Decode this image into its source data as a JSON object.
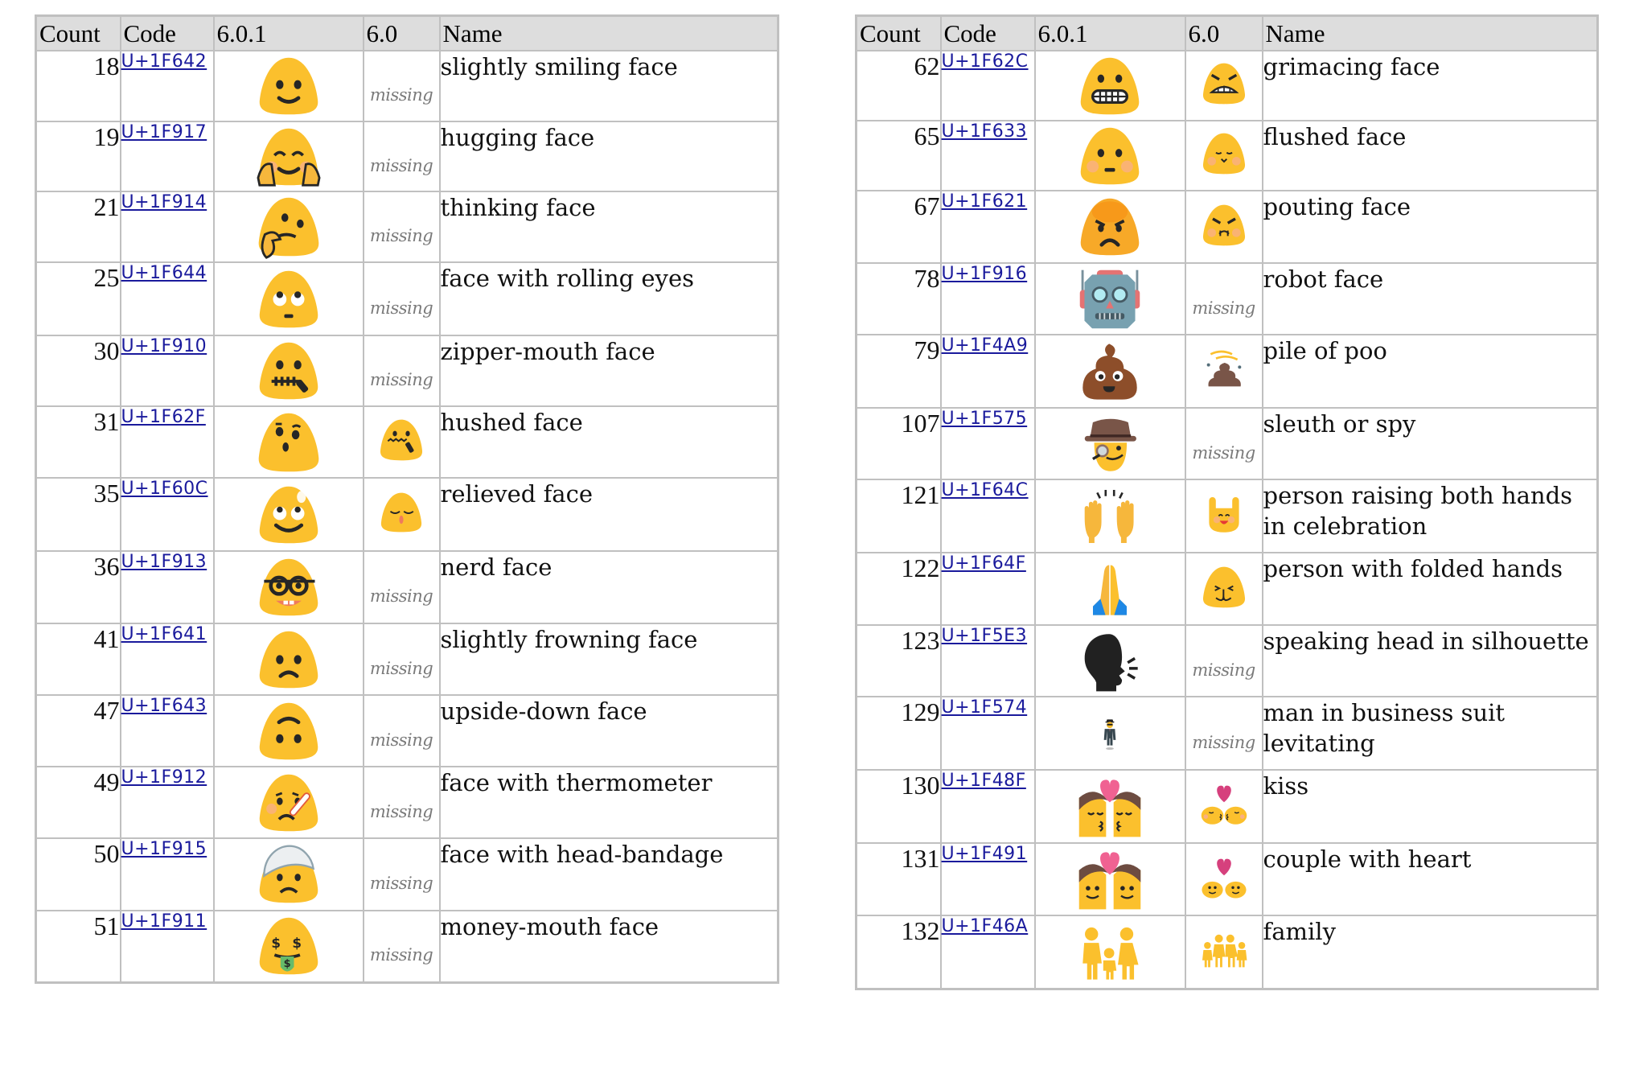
{
  "columns": [
    "Count",
    "Code",
    "6.0.1",
    "6.0",
    "Name"
  ],
  "missing_label": "missing",
  "colors": {
    "header_bg": "#dddddd",
    "border": "#c0c0c0",
    "link": "#1a1a9c",
    "missing_text": "#7a7a7a",
    "emoji_yellow": "#FBC02D"
  },
  "tables": [
    {
      "rows": [
        {
          "count": "18",
          "code": "U+1F642",
          "name": "slightly smiling face",
          "new_icon": "slightly-smiling-face",
          "old_icon": null
        },
        {
          "count": "19",
          "code": "U+1F917",
          "name": "hugging face",
          "new_icon": "hugging-face",
          "old_icon": null
        },
        {
          "count": "21",
          "code": "U+1F914",
          "name": "thinking face",
          "new_icon": "thinking-face",
          "old_icon": null
        },
        {
          "count": "25",
          "code": "U+1F644",
          "name": "face with rolling eyes",
          "new_icon": "rolling-eyes-face",
          "old_icon": null
        },
        {
          "count": "30",
          "code": "U+1F910",
          "name": "zipper-mouth face",
          "new_icon": "zipper-mouth-face",
          "old_icon": null
        },
        {
          "count": "31",
          "code": "U+1F62F",
          "name": "hushed face",
          "new_icon": "hushed-face",
          "old_icon": "hushed-face-old"
        },
        {
          "count": "35",
          "code": "U+1F60C",
          "name": "relieved face",
          "new_icon": "relieved-face",
          "old_icon": "relieved-face-old"
        },
        {
          "count": "36",
          "code": "U+1F913",
          "name": "nerd face",
          "new_icon": "nerd-face",
          "old_icon": null
        },
        {
          "count": "41",
          "code": "U+1F641",
          "name": "slightly frowning face",
          "new_icon": "slightly-frowning-face",
          "old_icon": null
        },
        {
          "count": "47",
          "code": "U+1F643",
          "name": "upside-down face",
          "new_icon": "upside-down-face",
          "old_icon": null
        },
        {
          "count": "49",
          "code": "U+1F912",
          "name": "face with thermometer",
          "new_icon": "thermometer-face",
          "old_icon": null
        },
        {
          "count": "50",
          "code": "U+1F915",
          "name": "face with head-bandage",
          "new_icon": "head-bandage-face",
          "old_icon": null
        },
        {
          "count": "51",
          "code": "U+1F911",
          "name": "money-mouth face",
          "new_icon": "money-mouth-face",
          "old_icon": null
        }
      ]
    },
    {
      "rows": [
        {
          "count": "62",
          "code": "U+1F62C",
          "name": "grimacing face",
          "new_icon": "grimacing-face",
          "old_icon": "grimacing-face-old"
        },
        {
          "count": "65",
          "code": "U+1F633",
          "name": "flushed face",
          "new_icon": "flushed-face",
          "old_icon": "flushed-face-old"
        },
        {
          "count": "67",
          "code": "U+1F621",
          "name": "pouting face",
          "new_icon": "pouting-face",
          "old_icon": "pouting-face-old"
        },
        {
          "count": "78",
          "code": "U+1F916",
          "name": "robot face",
          "new_icon": "robot-face",
          "old_icon": null
        },
        {
          "count": "79",
          "code": "U+1F4A9",
          "name": "pile of poo",
          "new_icon": "pile-of-poo",
          "old_icon": "pile-of-poo-old"
        },
        {
          "count": "107",
          "code": "U+1F575",
          "name": "sleuth or spy",
          "new_icon": "sleuth",
          "old_icon": null
        },
        {
          "count": "121",
          "code": "U+1F64C",
          "name": "person raising both hands in celebration",
          "new_icon": "raising-hands",
          "old_icon": "raising-hands-old"
        },
        {
          "count": "122",
          "code": "U+1F64F",
          "name": "person with folded hands",
          "new_icon": "folded-hands",
          "old_icon": "folded-hands-old"
        },
        {
          "count": "123",
          "code": "U+1F5E3",
          "name": "speaking head in silhouette",
          "new_icon": "speaking-head",
          "old_icon": null
        },
        {
          "count": "129",
          "code": "U+1F574",
          "name": "man in business suit levitating",
          "new_icon": "levitating-man",
          "old_icon": null
        },
        {
          "count": "130",
          "code": "U+1F48F",
          "name": "kiss",
          "new_icon": "kiss",
          "old_icon": "kiss-old"
        },
        {
          "count": "131",
          "code": "U+1F491",
          "name": "couple with heart",
          "new_icon": "couple-with-heart",
          "old_icon": "couple-with-heart-old"
        },
        {
          "count": "132",
          "code": "U+1F46A",
          "name": "family",
          "new_icon": "family",
          "old_icon": "family-old"
        }
      ]
    }
  ]
}
